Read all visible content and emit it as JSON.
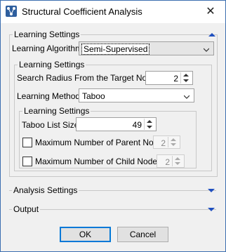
{
  "window": {
    "title": "Structural Coefficient Analysis",
    "close_glyph": "✕",
    "app_icon": "network-graph-icon"
  },
  "learning_section": {
    "legend": "Learning Settings",
    "algorithm_label": "Learning Algorithm",
    "algorithm_value": "Semi-Supervised",
    "inner": {
      "legend": "Learning Settings",
      "search_radius_label": "Search Radius From the Target Node",
      "search_radius_value": "2",
      "method_label": "Learning Method",
      "method_value": "Taboo",
      "taboo": {
        "legend": "Learning Settings",
        "list_size_label": "Taboo List Size",
        "list_size_value": "49",
        "max_parents_label": "Maximum Number of Parent Nodes",
        "max_parents_value": "2",
        "max_parents_checked": false,
        "max_children_label": "Maximum Number of Child Nodes",
        "max_children_value": "2",
        "max_children_checked": false
      }
    }
  },
  "analysis_section": {
    "legend": "Analysis Settings"
  },
  "output_section": {
    "legend": "Output"
  },
  "buttons": {
    "ok": "OK",
    "cancel": "Cancel"
  },
  "colors": {
    "accent": "#1f4fbf",
    "window_border": "#3c6fb0",
    "dialog_bg": "#f0f0f0"
  }
}
